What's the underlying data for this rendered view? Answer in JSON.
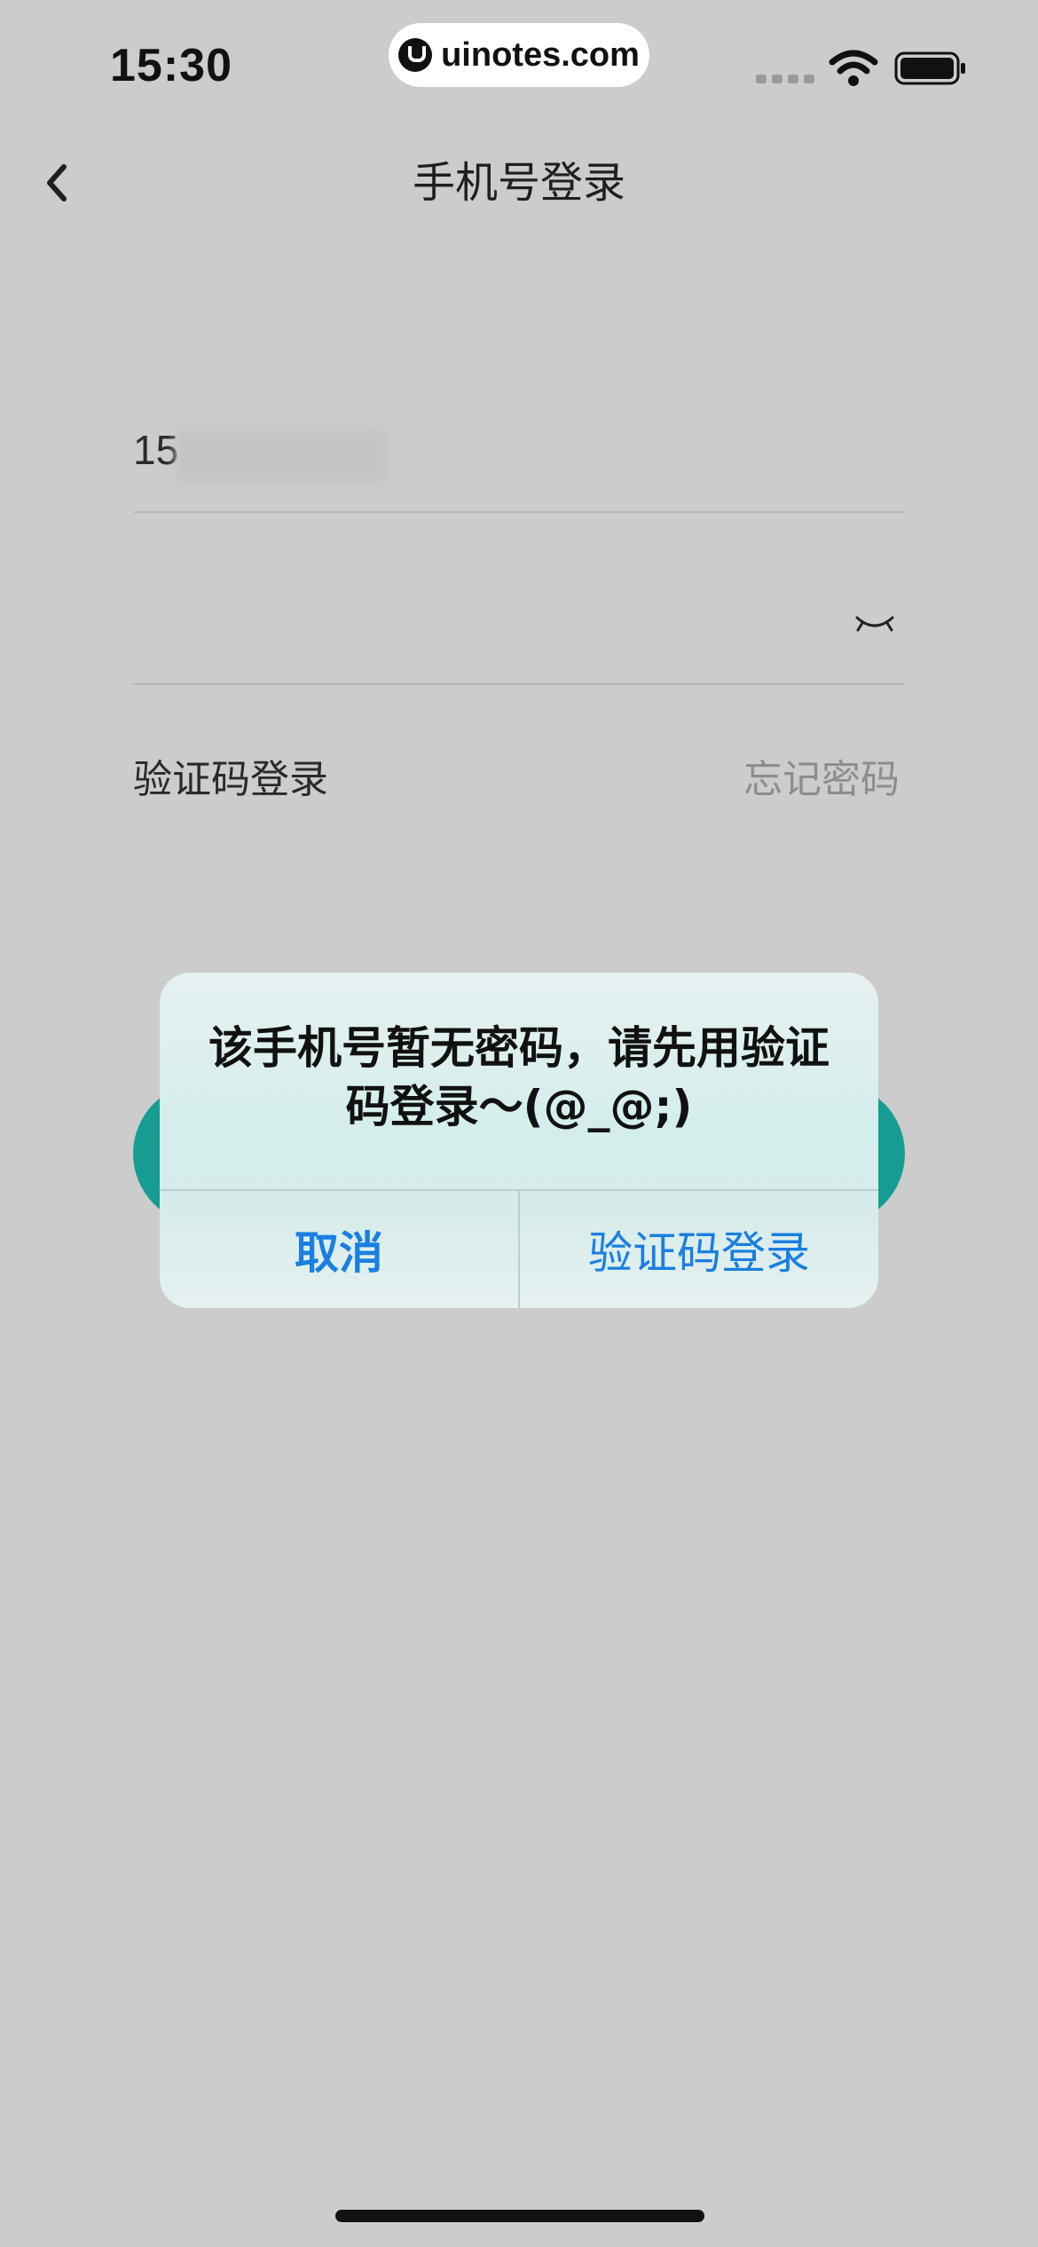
{
  "status_bar": {
    "time": "15:30",
    "watermark": "uinotes.com",
    "icons": [
      "signal-dots-icon",
      "wifi-icon",
      "battery-icon"
    ]
  },
  "nav": {
    "title": "手机号登录",
    "back_icon": "chevron-left-icon"
  },
  "form": {
    "phone_value": "15",
    "password_value": "",
    "eye_icon": "eye-closed-icon",
    "code_login_label": "验证码登录",
    "forgot_password_label": "忘记密码"
  },
  "dialog": {
    "message": "该手机号暂无密码，请先用验证码登录～(@_@;)",
    "cancel_label": "取消",
    "confirm_label": "验证码登录"
  },
  "colors": {
    "background": "#cccccc",
    "accent": "#169c92",
    "dialog_button": "#1a7fe0"
  }
}
